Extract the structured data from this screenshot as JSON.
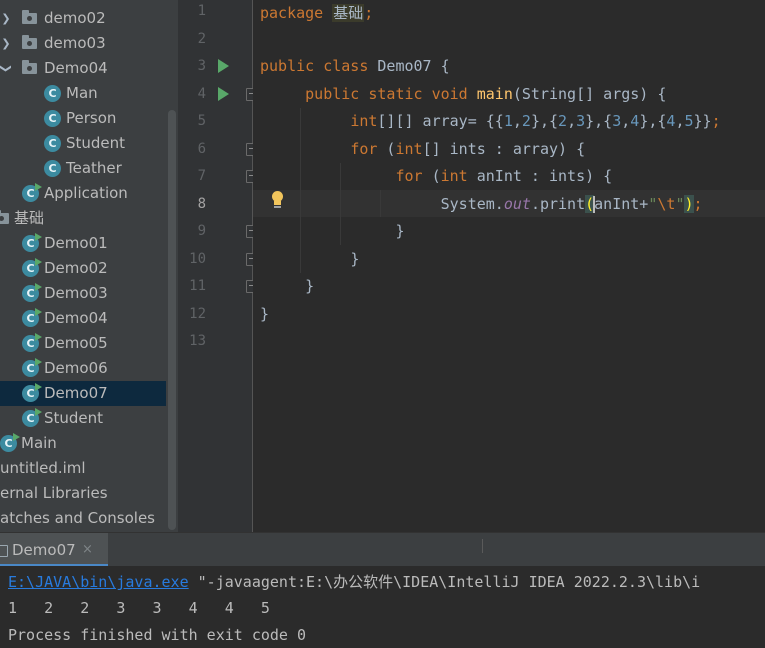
{
  "project_tree": {
    "items": [
      {
        "label": "demo02",
        "kind": "folder",
        "expanded": false
      },
      {
        "label": "demo03",
        "kind": "folder",
        "expanded": false
      },
      {
        "label": "Demo04",
        "kind": "folder",
        "expanded": true
      },
      {
        "label": "Man",
        "kind": "class"
      },
      {
        "label": "Person",
        "kind": "class"
      },
      {
        "label": "Student",
        "kind": "class"
      },
      {
        "label": "Teather",
        "kind": "class"
      },
      {
        "label": "Application",
        "kind": "runnable-class"
      },
      {
        "label": "基础",
        "kind": "folder",
        "expanded": true
      },
      {
        "label": "Demo01",
        "kind": "runnable-class"
      },
      {
        "label": "Demo02",
        "kind": "runnable-class"
      },
      {
        "label": "Demo03",
        "kind": "runnable-class"
      },
      {
        "label": "Demo04",
        "kind": "runnable-class"
      },
      {
        "label": "Demo05",
        "kind": "runnable-class"
      },
      {
        "label": "Demo06",
        "kind": "runnable-class"
      },
      {
        "label": "Demo07",
        "kind": "runnable-class",
        "selected": true
      },
      {
        "label": "Student",
        "kind": "runnable-class"
      },
      {
        "label": "Main",
        "kind": "runnable-class"
      },
      {
        "label": "untitled.iml",
        "kind": "file"
      },
      {
        "label": "ernal Libraries",
        "kind": "library"
      },
      {
        "label": "atches and Consoles",
        "kind": "scratch"
      }
    ],
    "class_icon_letter": "C"
  },
  "editor": {
    "line_numbers": [
      "1",
      "2",
      "3",
      "4",
      "5",
      "6",
      "7",
      "8",
      "9",
      "10",
      "11",
      "12",
      "13"
    ],
    "current_line": "8",
    "code": {
      "l1_package_kw": "package",
      "l1_package_name": "基础",
      "l1_semi": ";",
      "l3_kw": "public class",
      "l3_name": "Demo07 {",
      "l4_kw": "public static void",
      "l4_fn": "main",
      "l4_rest": "(String[] args) {",
      "l5_kw": "int",
      "l5_a": "[][] array= {{",
      "l5_n1": "1",
      "l5_n2": "2",
      "l5_n3": "2",
      "l5_n4": "3",
      "l5_n5": "3",
      "l5_n6": "4",
      "l5_n7": "4",
      "l5_n8": "5",
      "l6_kw": "for",
      "l6_kw2": "int",
      "l6_rest": "[] ints : array) {",
      "l7_kw": "for",
      "l7_kw2": "int",
      "l7_rest": " anInt : ints) {",
      "l8_a": "System.",
      "l8_field": "out",
      "l8_b": ".print",
      "l8_c": "anInt+",
      "l8_str_open": "\"",
      "l8_esc": "\\t",
      "l8_str_close": "\"",
      "l8_end": ");",
      "close_brace": "}"
    }
  },
  "run_panel": {
    "tab_label": "Demo07",
    "close_glyph": "×",
    "console": {
      "java_path": "E:\\JAVA\\bin\\java.exe",
      "cmd_rest": " \"-javaagent:E:\\办公软件\\IDEA\\IntelliJ IDEA 2022.2.3\\lib\\i",
      "output": "1   2   2   3   3   4   4   5",
      "exit_msg": "Process finished with exit code 0"
    }
  },
  "colors": {
    "keyword": "#cc7832",
    "method": "#ffc66d",
    "number": "#6897bb",
    "string": "#6a8759",
    "field": "#9876aa",
    "selection": "#0d293e",
    "link": "#287bde"
  }
}
